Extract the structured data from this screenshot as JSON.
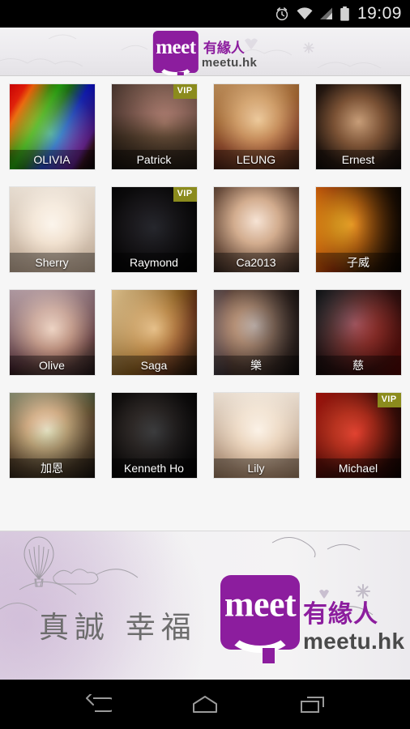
{
  "status_bar": {
    "time": "19:09",
    "icons": [
      "alarm-clock-icon",
      "wifi-icon",
      "signal-bars-icon",
      "battery-icon"
    ]
  },
  "header": {
    "logo": {
      "mark_text": "meet",
      "chinese_name": "有緣人",
      "domain": "meetu.hk"
    }
  },
  "grid": {
    "vip_label": "VIP",
    "profiles": [
      {
        "name": "OLIVIA",
        "vip": false
      },
      {
        "name": "Patrick",
        "vip": true
      },
      {
        "name": "LEUNG",
        "vip": false
      },
      {
        "name": "Ernest",
        "vip": false
      },
      {
        "name": "Sherry",
        "vip": false
      },
      {
        "name": "Raymond",
        "vip": true
      },
      {
        "name": "Ca2013",
        "vip": false
      },
      {
        "name": "子威",
        "vip": false
      },
      {
        "name": "Olive",
        "vip": false
      },
      {
        "name": "Saga",
        "vip": false
      },
      {
        "name": "樂",
        "vip": false
      },
      {
        "name": "慈",
        "vip": false
      },
      {
        "name": "加恩",
        "vip": false
      },
      {
        "name": "Kenneth Ho",
        "vip": false
      },
      {
        "name": "Lily",
        "vip": false
      },
      {
        "name": "Michael",
        "vip": true
      }
    ]
  },
  "footer": {
    "slogan": "真誠 幸福",
    "logo": {
      "mark_text": "meet",
      "chinese_name": "有緣人",
      "domain": "meetu.hk"
    },
    "decorations": [
      "hot-air-balloon-sketch",
      "cloud-sketch",
      "heart-sketch",
      "snowflake-sketch"
    ]
  },
  "navbar": {
    "buttons": [
      {
        "name": "back-button",
        "icon": "back-arrow-icon"
      },
      {
        "name": "home-button",
        "icon": "home-icon"
      },
      {
        "name": "recents-button",
        "icon": "recent-apps-icon"
      }
    ]
  },
  "colors": {
    "brand_purple": "#8c1d9e",
    "vip_olive": "#8b8b1d",
    "grid_bg": "#f6f6f6",
    "bar_black": "#000000"
  }
}
